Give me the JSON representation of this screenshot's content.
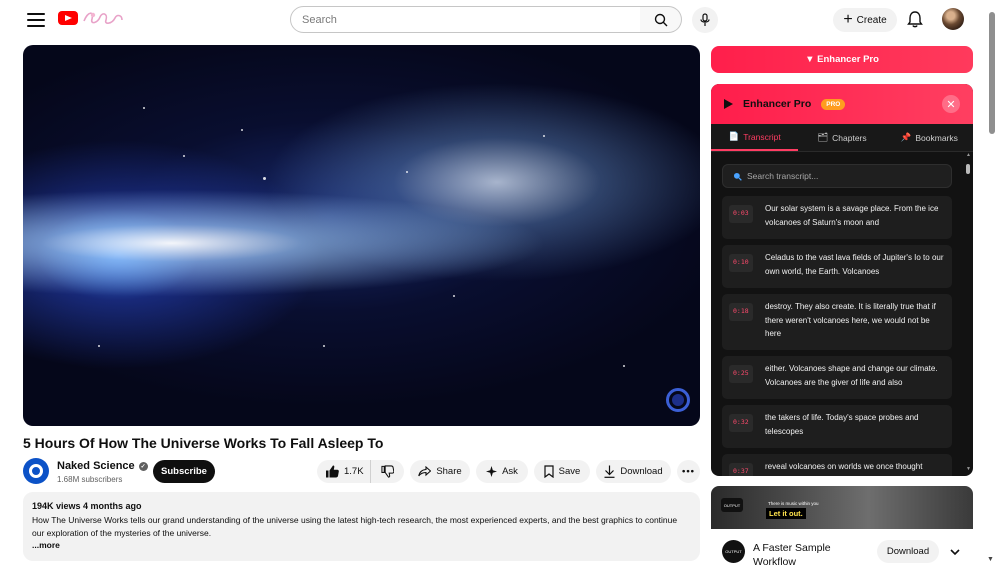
{
  "topbar": {
    "search_placeholder": "Search",
    "create_label": "Create"
  },
  "video": {
    "title": "5 Hours Of How The Universe Works To Fall Asleep To",
    "channel_name": "Naked Science",
    "subscribers": "1.68M subscribers",
    "subscribe_label": "Subscribe",
    "likes": "1.7K",
    "share_label": "Share",
    "ask_label": "Ask",
    "save_label": "Save",
    "download_label": "Download",
    "more_label": "•••"
  },
  "description": {
    "meta": "194K views  4 months ago",
    "text": "How The Universe Works tells our grand understanding of the universe using the latest high-tech research, the most experienced experts, and the best graphics to continue our exploration of the mysteries of the universe.",
    "more": "...more"
  },
  "enhancer": {
    "top_button": "▼ Enhancer Pro",
    "panel_title": "Enhancer Pro",
    "pro_badge": "PRO",
    "close": "✕",
    "tabs": [
      {
        "icon": "📄",
        "label": "Transcript"
      },
      {
        "icon": "🗂",
        "label": "Chapters"
      },
      {
        "icon": "📌",
        "label": "Bookmarks"
      }
    ],
    "search_placeholder": "Search transcript...",
    "segments": [
      {
        "time": "0:03",
        "text": "Our solar system is a savage place. From the ice volcanoes of Saturn's moon and"
      },
      {
        "time": "0:10",
        "text": "Celadus to the vast lava fields of Jupiter's Io to our own world, the Earth. Volcanoes"
      },
      {
        "time": "0:18",
        "text": "destroy. They also create. It is literally true that if there weren't volcanoes here, we would not be here"
      },
      {
        "time": "0:25",
        "text": "either. Volcanoes shape and change our climate. Volcanoes are the giver of life and also"
      },
      {
        "time": "0:32",
        "text": "the takers of life. Today's space probes and telescopes"
      },
      {
        "time": "0:37",
        "text": "reveal volcanoes on worlds we once thought"
      }
    ]
  },
  "suggested": {
    "thumb_small": "There is music within you",
    "thumb_caption": "Let it out.",
    "logo_text": "OUTPUT",
    "title": "A Faster Sample Workflow",
    "download_label": "Download"
  },
  "colors": {
    "accent": "#ff2d55",
    "pro_badge": "#ff9d1f",
    "subscribe_bg": "#0f0f0f"
  }
}
